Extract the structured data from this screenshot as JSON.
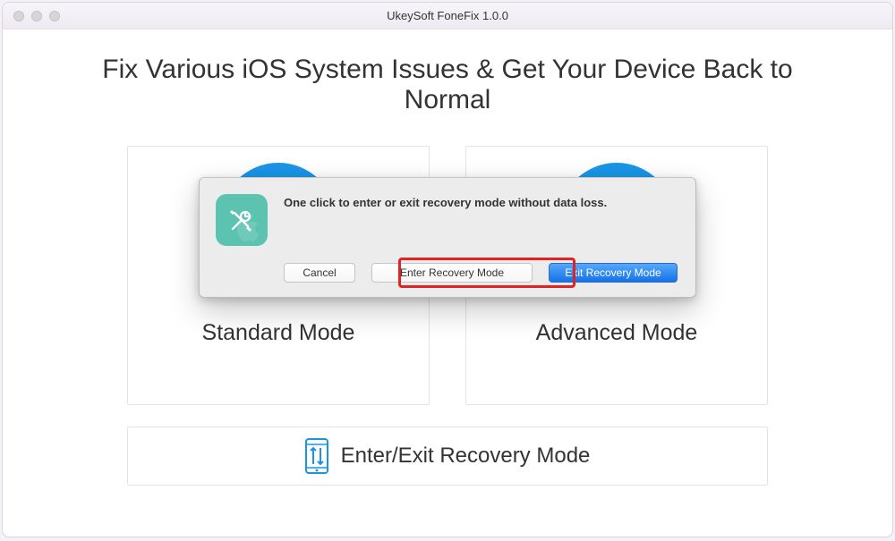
{
  "window": {
    "title": "UkeySoft FoneFix 1.0.0"
  },
  "heading": "Fix Various iOS System Issues & Get Your Device Back to Normal",
  "modes": {
    "standard": "Standard Mode",
    "advanced": "Advanced Mode"
  },
  "recovery_bar": {
    "label": "Enter/Exit Recovery Mode"
  },
  "modal": {
    "message": "One click to enter or exit recovery mode without data loss.",
    "buttons": {
      "cancel": "Cancel",
      "enter": "Enter Recovery Mode",
      "exit": "Exit Recovery Mode"
    },
    "icon_color": "#5bc3b0"
  },
  "accent_color": "#1a95e6"
}
